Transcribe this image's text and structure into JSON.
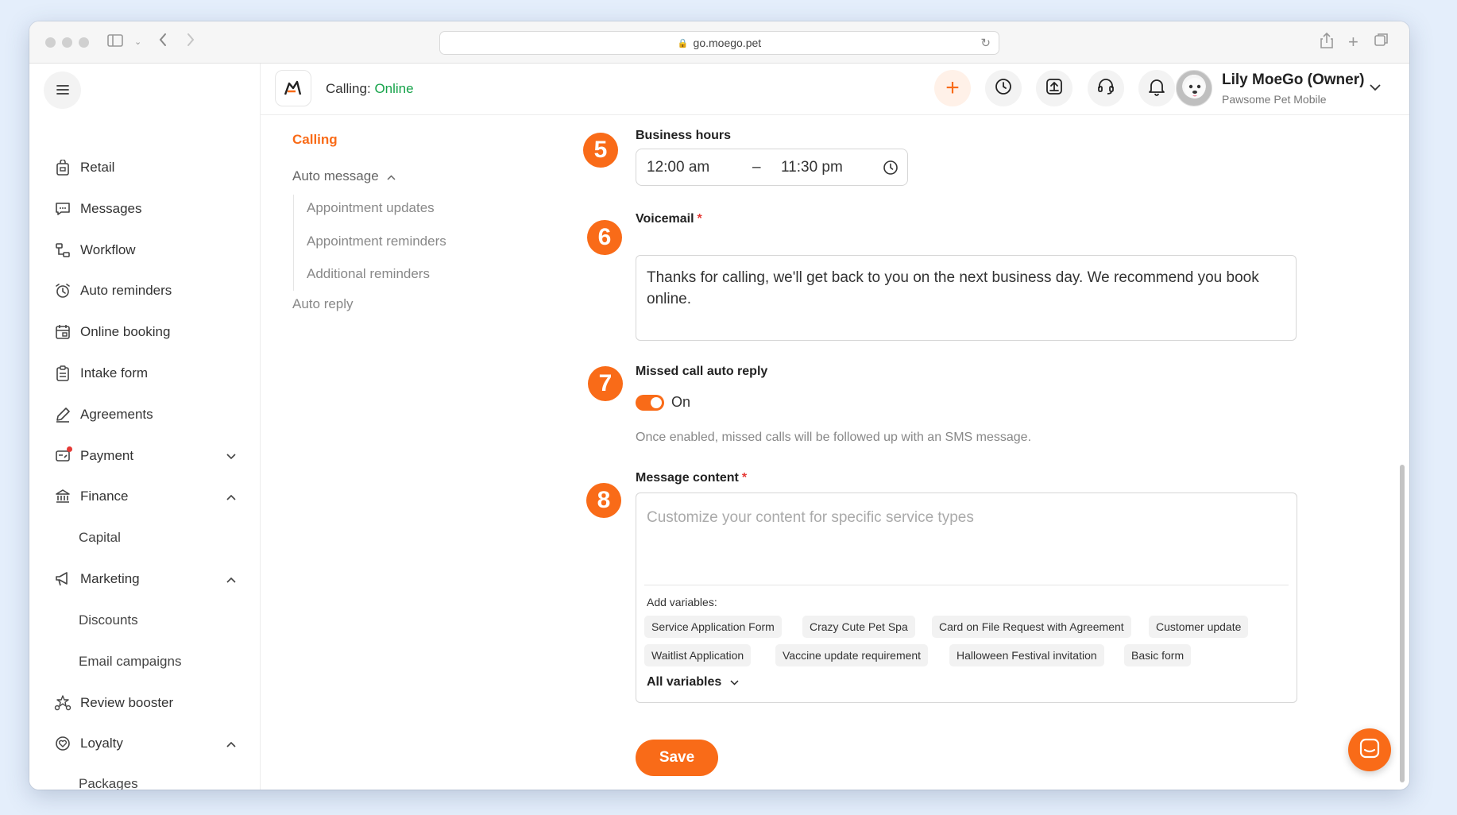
{
  "browser": {
    "url": "go.moego.pet"
  },
  "header": {
    "calling_label": "Calling:",
    "calling_status": "Online",
    "user_name": "Lily MoeGo (Owner)",
    "business_name": "Pawsome Pet Mobile"
  },
  "sidebar": {
    "items": [
      {
        "label": "Retail",
        "icon": "bag-icon"
      },
      {
        "label": "Messages",
        "icon": "message-icon"
      },
      {
        "label": "Workflow",
        "icon": "workflow-icon"
      },
      {
        "label": "Auto reminders",
        "icon": "alarm-clock-icon"
      },
      {
        "label": "Online booking",
        "icon": "calendar-icon"
      },
      {
        "label": "Intake form",
        "icon": "clipboard-icon"
      },
      {
        "label": "Agreements",
        "icon": "pen-icon"
      },
      {
        "label": "Payment",
        "icon": "payment-icon"
      },
      {
        "label": "Finance",
        "icon": "bank-icon"
      },
      {
        "label": "Marketing",
        "icon": "megaphone-icon"
      },
      {
        "label": "Review booster",
        "icon": "stars-icon"
      },
      {
        "label": "Loyalty",
        "icon": "heart-badge-icon"
      }
    ],
    "sub": {
      "capital": "Capital",
      "discounts": "Discounts",
      "email_campaigns": "Email campaigns",
      "packages": "Packages"
    }
  },
  "subnav": {
    "calling": "Calling",
    "auto_message": "Auto message",
    "appointment_updates": "Appointment updates",
    "appointment_reminders": "Appointment reminders",
    "additional_reminders": "Additional reminders",
    "auto_reply": "Auto reply"
  },
  "form": {
    "steps": [
      "5",
      "6",
      "7",
      "8"
    ],
    "business_hours": {
      "label": "Business hours",
      "start": "12:00 am",
      "separator": "–",
      "end": "11:30 pm"
    },
    "voicemail": {
      "label": "Voicemail",
      "value": "Thanks for calling, we'll get back to you on the next business day. We recommend you book online."
    },
    "missed_call": {
      "label": "Missed call auto reply",
      "toggle_label": "On",
      "hint": "Once enabled, missed calls will be followed up with an SMS message."
    },
    "message_content": {
      "label": "Message content",
      "placeholder": "Customize your content for specific service types",
      "vars_label": "Add variables:",
      "variables": [
        "Service Application Form",
        "Crazy Cute Pet Spa",
        "Card on File Request with Agreement",
        "Customer update",
        "Waitlist Application",
        "Vaccine update requirement",
        "Halloween Festival invitation",
        "Basic form"
      ],
      "all_variables": "All variables"
    },
    "required_mark": "*",
    "save_label": "Save"
  },
  "colors": {
    "accent": "#f96b18",
    "online": "#16a34a",
    "required": "#e53935"
  }
}
